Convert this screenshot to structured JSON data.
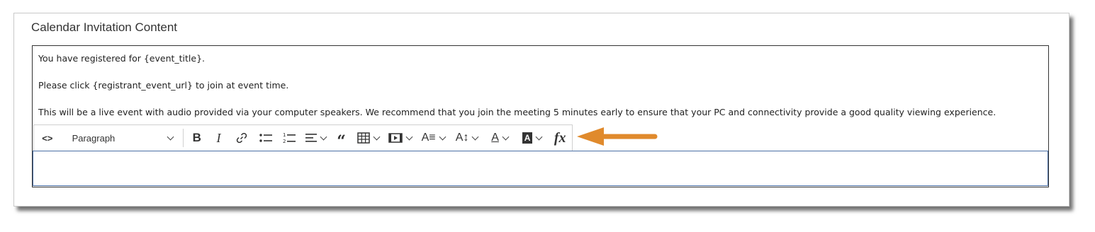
{
  "section": {
    "title": "Calendar Invitation Content"
  },
  "editor": {
    "paragraphs": [
      "You have registered for {event_title}.",
      "Please click {registrant_event_url} to join at event time.",
      "This will be a live event with audio provided via your computer speakers. We recommend that you join the meeting 5 minutes early to ensure that your PC and connectivity provide a good quality viewing experience."
    ],
    "toolbar": {
      "source_label": "<>",
      "paragraph_select": "Paragraph",
      "fx_label": "fx"
    }
  },
  "colors": {
    "arrow": "#e08a2c",
    "input_border": "#4a6fa5"
  }
}
